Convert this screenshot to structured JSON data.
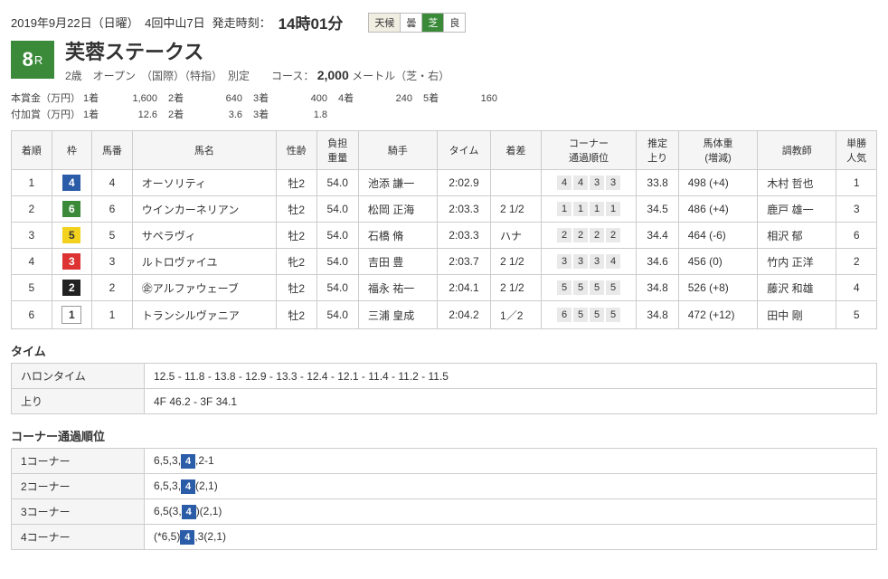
{
  "header": {
    "date_text": "2019年9月22日（日曜）　4回中山7日",
    "start_label": "発走時刻：",
    "start_time": "14時01分",
    "cond_weather_label": "天候",
    "cond_weather_val": "曇",
    "cond_turf_label": "芝",
    "cond_turf_val": "良"
  },
  "race": {
    "number": "8",
    "number_suffix": "R",
    "name": "芙蓉ステークス",
    "sub_prefix": "2歳　オープン　（国際）（特指）　別定　　コース：",
    "course": "2,000",
    "course_suffix": "メートル（芝・右）"
  },
  "prize": {
    "main_label": "本賞金（万円）",
    "add_label": "付加賞（万円）",
    "ranks": [
      "1着",
      "2着",
      "3着",
      "4着",
      "5着"
    ],
    "main": [
      "1,600",
      "640",
      "400",
      "240",
      "160"
    ],
    "add": [
      "12.6",
      "3.6",
      "1.8"
    ]
  },
  "columns": {
    "rank": "着順",
    "waku": "枠",
    "num": "馬番",
    "name": "馬名",
    "sex": "性齢",
    "weight": "負担\n重量",
    "jockey": "騎手",
    "time": "タイム",
    "margin": "着差",
    "corner": "コーナー\n通過順位",
    "agari": "推定\n上り",
    "bweight": "馬体重\n(増減)",
    "trainer": "調教師",
    "pop": "単勝\n人気"
  },
  "results": [
    {
      "rank": "1",
      "waku": "4",
      "waku_class": "waku-4",
      "num": "4",
      "name": "オーソリティ",
      "sex": "牡2",
      "weight": "54.0",
      "jockey": "池添 謙一",
      "time": "2:02.9",
      "margin": "",
      "corner": [
        "4",
        "4",
        "3",
        "3"
      ],
      "agari": "33.8",
      "bweight": "498 (+4)",
      "trainer": "木村 哲也",
      "pop": "1"
    },
    {
      "rank": "2",
      "waku": "6",
      "waku_class": "waku-6",
      "num": "6",
      "name": "ウインカーネリアン",
      "sex": "牡2",
      "weight": "54.0",
      "jockey": "松岡 正海",
      "time": "2:03.3",
      "margin": "2 1/2",
      "corner": [
        "1",
        "1",
        "1",
        "1"
      ],
      "agari": "34.5",
      "bweight": "486 (+4)",
      "trainer": "鹿戸 雄一",
      "pop": "3"
    },
    {
      "rank": "3",
      "waku": "5",
      "waku_class": "waku-5",
      "num": "5",
      "name": "サペラヴィ",
      "sex": "牡2",
      "weight": "54.0",
      "jockey": "石橋 脩",
      "time": "2:03.3",
      "margin": "ハナ",
      "corner": [
        "2",
        "2",
        "2",
        "2"
      ],
      "agari": "34.4",
      "bweight": "464 (-6)",
      "trainer": "相沢 郁",
      "pop": "6"
    },
    {
      "rank": "4",
      "waku": "3",
      "waku_class": "waku-3",
      "num": "3",
      "name": "ルトロヴァイユ",
      "sex": "牝2",
      "weight": "54.0",
      "jockey": "吉田 豊",
      "time": "2:03.7",
      "margin": "2 1/2",
      "corner": [
        "3",
        "3",
        "3",
        "4"
      ],
      "agari": "34.6",
      "bweight": "456 (0)",
      "trainer": "竹内 正洋",
      "pop": "2"
    },
    {
      "rank": "5",
      "waku": "2",
      "waku_class": "waku-2",
      "num": "2",
      "name": "㊭アルファウェーブ",
      "sex": "牡2",
      "weight": "54.0",
      "jockey": "福永 祐一",
      "time": "2:04.1",
      "margin": "2 1/2",
      "corner": [
        "5",
        "5",
        "5",
        "5"
      ],
      "agari": "34.8",
      "bweight": "526 (+8)",
      "trainer": "藤沢 和雄",
      "pop": "4"
    },
    {
      "rank": "6",
      "waku": "1",
      "waku_class": "waku-1",
      "num": "1",
      "name": "トランシルヴァニア",
      "sex": "牡2",
      "weight": "54.0",
      "jockey": "三浦 皇成",
      "time": "2:04.2",
      "margin": "1／2",
      "corner": [
        "6",
        "5",
        "5",
        "5"
      ],
      "agari": "34.8",
      "bweight": "472 (+12)",
      "trainer": "田中 剛",
      "pop": "5"
    }
  ],
  "time_section": {
    "title": "タイム",
    "furlong_label": "ハロンタイム",
    "furlong_val": "12.5 - 11.8 - 13.8 - 12.9 - 13.3 - 12.4 - 12.1 - 11.4 - 11.2 - 11.5",
    "agari_label": "上り",
    "agari_val": "4F 46.2 - 3F 34.1"
  },
  "corner_section": {
    "title": "コーナー通過順位",
    "rows": [
      {
        "label": "1コーナー",
        "parts": [
          {
            "t": "6,5,3,"
          },
          {
            "w": "4",
            "c": "waku-4"
          },
          {
            "t": ",2-1"
          }
        ]
      },
      {
        "label": "2コーナー",
        "parts": [
          {
            "t": "6,5,3,"
          },
          {
            "w": "4",
            "c": "waku-4"
          },
          {
            "t": "(2,1)"
          }
        ]
      },
      {
        "label": "3コーナー",
        "parts": [
          {
            "t": "6,5(3,"
          },
          {
            "w": "4",
            "c": "waku-4"
          },
          {
            "t": ")(2,1)"
          }
        ]
      },
      {
        "label": "4コーナー",
        "parts": [
          {
            "t": "(*6,5)"
          },
          {
            "w": "4",
            "c": "waku-4"
          },
          {
            "t": ",3(2,1)"
          }
        ]
      }
    ]
  }
}
